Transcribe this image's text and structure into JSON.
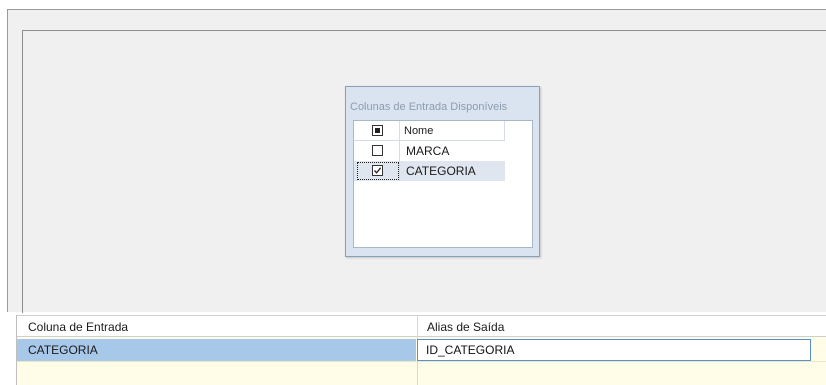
{
  "input_columns": {
    "title": "Colunas de Entrada Disponíveis",
    "header": "Nome",
    "rows": [
      {
        "label": "MARCA",
        "checked": false
      },
      {
        "label": "CATEGORIA",
        "checked": true
      }
    ]
  },
  "mapping_grid": {
    "columns": [
      "Coluna de Entrada",
      "Alias de Saída"
    ],
    "rows": [
      {
        "input": "CATEGORIA",
        "alias": "ID_CATEGORIA"
      }
    ]
  },
  "colors": {
    "selected_row": "#a8c8ea",
    "grid_background": "#fffde8",
    "designer_background": "#f0f0f0",
    "input_border_focus": "#5b8fd1"
  }
}
